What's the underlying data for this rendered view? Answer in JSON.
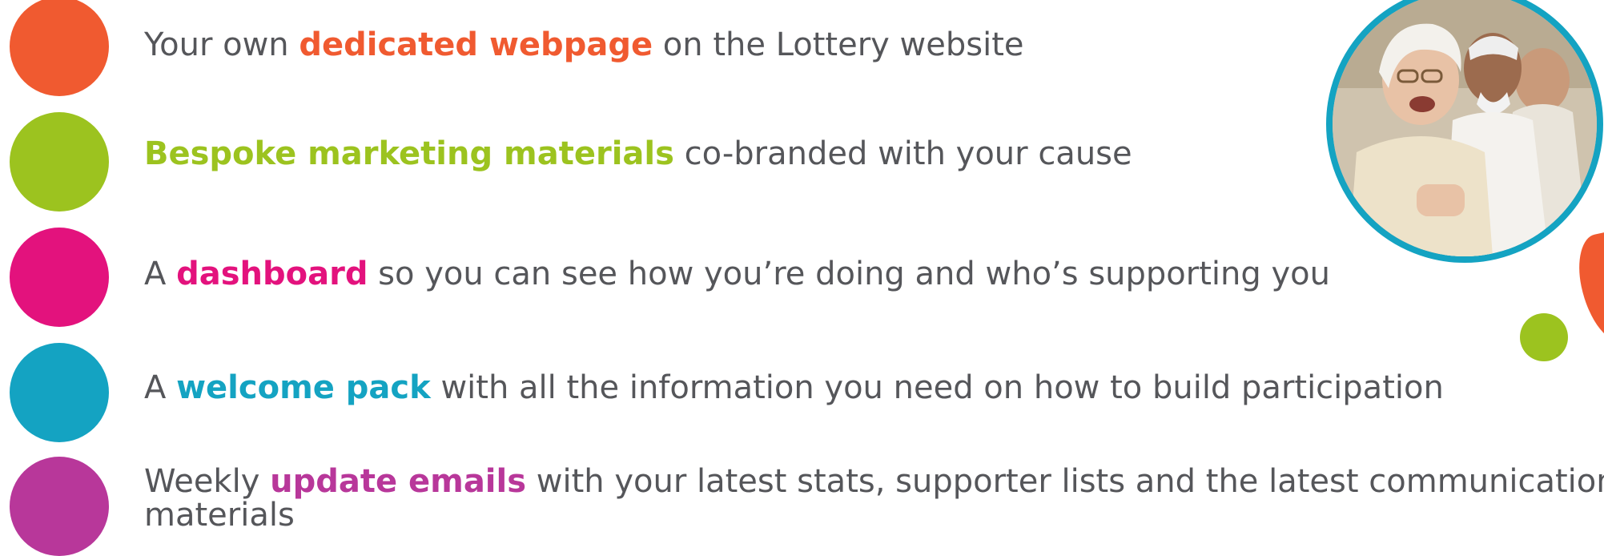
{
  "colors": {
    "orange": "#f05a30",
    "green": "#9cc31f",
    "pink": "#e3127d",
    "teal": "#14a3c2",
    "purple": "#b8379a",
    "text": "#55565a"
  },
  "benefits": [
    {
      "before": "Your own ",
      "highlight": "dedicated webpage",
      "after": " on the Lottery website",
      "color": "orange"
    },
    {
      "before": "",
      "highlight": "Bespoke marketing materials",
      "after": " co-branded with your cause",
      "color": "green"
    },
    {
      "before": "A ",
      "highlight": "dashboard",
      "after": " so you can see how you’re doing and who’s supporting you",
      "color": "pink"
    },
    {
      "before": "A ",
      "highlight": "welcome pack",
      "after": " with all the information you need on how to build participation",
      "color": "teal"
    },
    {
      "before": "Weekly ",
      "highlight": "update emails",
      "after": " with your latest stats, supporter lists and the latest communication materials",
      "color": "purple"
    }
  ]
}
